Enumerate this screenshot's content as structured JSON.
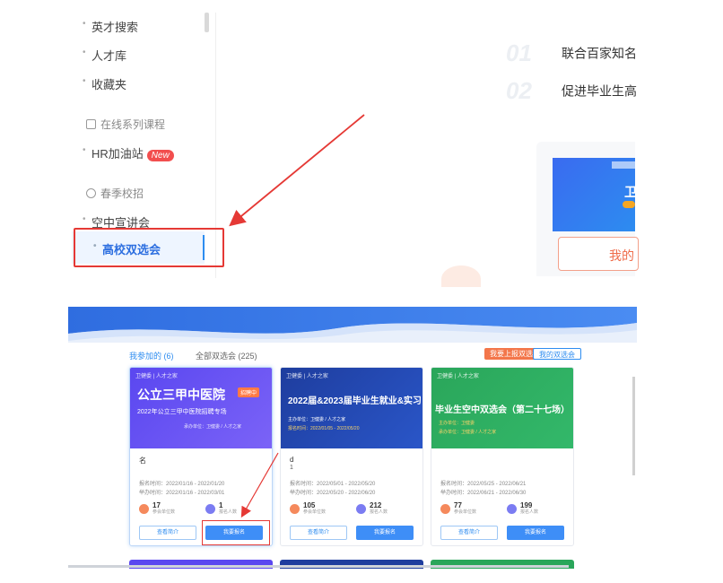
{
  "sidebar": {
    "items": [
      {
        "label": "英才搜索"
      },
      {
        "label": "人才库"
      },
      {
        "label": "收藏夹"
      }
    ],
    "group_online": {
      "label": "在线系列课程"
    },
    "hr_item": {
      "label": "HR加油站",
      "badge": "New"
    },
    "group_campus": {
      "label": "春季校招"
    },
    "campus_items": [
      {
        "label": "空中宣讲会"
      }
    ],
    "active_item": {
      "label": "高校双选会"
    }
  },
  "features": [
    {
      "num": "01",
      "text": "联合百家知名"
    },
    {
      "num": "02",
      "text": "促进毕业生高"
    }
  ],
  "right_card": {
    "banner_title": "卫",
    "button_label": "我的"
  },
  "list_page": {
    "tabs": {
      "mine": "我参加的 (6)",
      "all": "全部双选会 (225)"
    },
    "btn_apply": "我要上报双选",
    "btn_mine": "我的双选会",
    "cards": [
      {
        "brand": "卫健委 | 人才之家",
        "title": "公立三甲中医院",
        "tag": "招聘中",
        "subtitle": "2022年公立三甲中医院招聘专场",
        "host_line": "承办单位：卫健委 / 人才之家",
        "name": "名",
        "name2": "",
        "date1": "报名时间：2022/01/16 - 2022/01/20",
        "date2": "举办时间：2022/01/16 - 2022/03/01",
        "companies": "17",
        "companies_label": "参会单位数",
        "people": "1",
        "people_label": "报名人数",
        "btn_view": "查看简介",
        "btn_join": "我要报名"
      },
      {
        "brand": "卫健委 | 人才之家",
        "title": "2022届&2023届毕业生就业&实习",
        "tag": "",
        "subtitle": "主办单位：卫健委 / 人才之家",
        "host_line": "报名时间：2022/01/05 - 2022/05/20",
        "name": "d",
        "name2": "1",
        "date1": "报名时间：2022/05/01 - 2022/05/20",
        "date2": "举办时间：2022/05/20 - 2022/06/20",
        "companies": "105",
        "companies_label": "参会单位数",
        "people": "212",
        "people_label": "报名人数",
        "btn_view": "查看简介",
        "btn_join": "我要报名"
      },
      {
        "brand": "卫健委 | 人才之家",
        "title": "毕业生空中双选会（第二十七场）",
        "tag": "",
        "subtitle": "主办单位：卫健委",
        "host_line": "承办单位：卫健委 / 人才之家",
        "name": "",
        "name2": "",
        "date1": "报名时间：2022/05/25 - 2022/06/21",
        "date2": "举办时间：2022/06/21 - 2022/06/30",
        "companies": "77",
        "companies_label": "参会单位数",
        "people": "199",
        "people_label": "报名人数",
        "btn_view": "查看简介",
        "btn_join": "我要报名"
      }
    ]
  },
  "colors": {
    "accent": "#2d8cf0",
    "red_highlight": "#e53935",
    "card1": "#5a47f0",
    "card2": "#1e3d9e",
    "card3": "#2aa65a"
  }
}
